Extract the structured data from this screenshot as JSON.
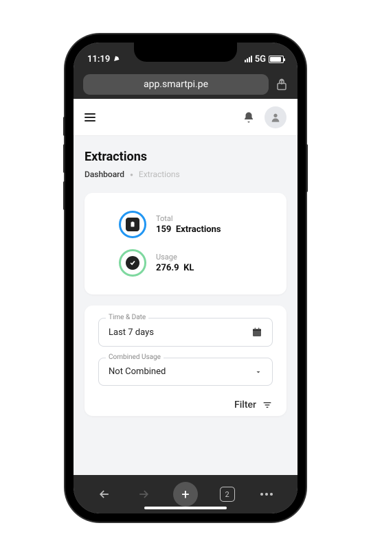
{
  "status": {
    "time": "11:19",
    "network": "5G"
  },
  "browser": {
    "url": "app.smartpi.pe",
    "tabCount": "2"
  },
  "page": {
    "title": "Extractions"
  },
  "breadcrumb": {
    "root": "Dashboard",
    "current": "Extractions"
  },
  "stats": {
    "total": {
      "label": "Total",
      "value": "159",
      "unit": "Extractions"
    },
    "usage": {
      "label": "Usage",
      "value": "276.9",
      "unit": "KL"
    }
  },
  "filters": {
    "timeDate": {
      "label": "Time & Date",
      "value": "Last 7 days"
    },
    "combinedUsage": {
      "label": "Combined Usage",
      "value": "Not Combined"
    },
    "actionLabel": "Filter"
  }
}
